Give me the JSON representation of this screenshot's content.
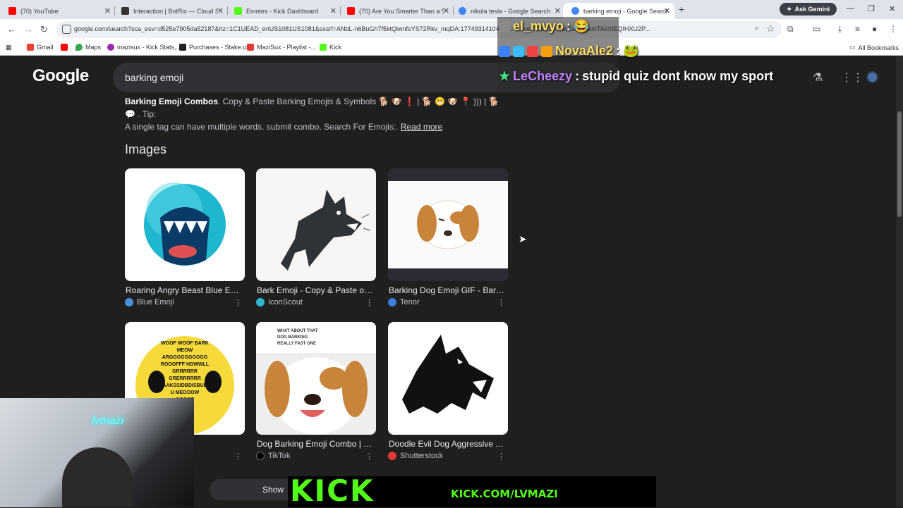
{
  "tabs": [
    {
      "title": "(70) YouTube",
      "icon": "youtube-icon",
      "color": "#ff0000"
    },
    {
      "title": "Interaction | BotRix — Cloud St...",
      "icon": "botrix-icon",
      "color": "#333333"
    },
    {
      "title": "Emotes - Kick Dashboard",
      "icon": "kick-icon",
      "color": "#53fc18"
    },
    {
      "title": "(70) Are You Smarter Than a 5th...",
      "icon": "youtube-icon",
      "color": "#ff0000"
    },
    {
      "title": "nikola tesla - Google Search",
      "icon": "google-icon",
      "color": "#4285f4"
    },
    {
      "title": "barking emoji - Google Search",
      "icon": "google-icon",
      "color": "#4285f4"
    }
  ],
  "ask_gemini": "Ask Gemini",
  "address_bar": {
    "url": "google.com/search?sca_esv=d525e7905da52187&rlz=1C1UEAD_enUS1081US1081&sxsrf=ANbL-n6BuGh7f5ktQiwnfsYS72Rkv_mqDA:1774931410483...=X&ved=2ahUKEwjXieHhpsmTAxXIEQIHXU2P..."
  },
  "bookmarks": [
    {
      "label": "Gmail",
      "color": "#ea4335"
    },
    {
      "label": "",
      "color": "#ff0000"
    },
    {
      "label": "Maps",
      "color": "#34a853"
    },
    {
      "label": "mazisux - Kick Stats,...",
      "color": "#9c27b0"
    },
    {
      "label": "Purchases - Stake.us",
      "color": "#222222"
    },
    {
      "label": "MaziSux - Playlist -...",
      "color": "#e53935"
    },
    {
      "label": "Kick",
      "color": "#53fc18"
    }
  ],
  "all_bookmarks": "All Bookmarks",
  "google": {
    "logo": "Google",
    "query": "barking emoji",
    "snippet_bold": "Barking Emoji Combos",
    "snippet_line1": ". Copy & Paste Barking Emojis & Symbols 🐕 🐶 ❗ | 🐕 😬 🐶 📍 ))) | 🐕 💬 . Tip:",
    "snippet_line2": "A single tag can have multiple words. submit combo. Search For Emojis:.",
    "read_more": "Read more",
    "images_heading": "Images",
    "images": [
      {
        "caption": "Roaring Angry Beast Blue Emoji",
        "source": "Blue Emoji",
        "source_color": "#4a90d9"
      },
      {
        "caption": "Bark Emoji - Copy & Paste or ...",
        "source": "IconScout",
        "source_color": "#2fb5d2"
      },
      {
        "caption": "Barking Dog Emoji GIF - Barki...",
        "source": "Tenor",
        "source_color": "#3b7ddd"
      },
      {
        "caption": "ark Sticker",
        "source": "",
        "source_color": "#888888"
      },
      {
        "caption": "Dog Barking Emoji Combo | Ti...",
        "source": "TikTok",
        "source_color": "#000000"
      },
      {
        "caption": "Doodle Evil Dog Aggressive A...",
        "source": "Shutterstock",
        "source_color": "#e53935"
      }
    ],
    "sticker_text": "WOOF WOOF BARK MEOW ARGGGGGGGGGG ROOOFFF HOWWLL GRRRRRR GRERRRRRR AAKSSIDBDISBUD U MEOOOW OOOOF",
    "tiktok_text": "WHAT ABOUT THAT DOG BARKING REALLY FAST ONE",
    "show_more": "Show"
  },
  "chat": [
    {
      "user": "el_mvyo",
      "message": "😂",
      "color": "#ffe066"
    },
    {
      "user": "NovaAle2",
      "message": "🐸",
      "color": "#ffe066"
    },
    {
      "user": "LeCheezy",
      "message": "stupid quiz dont know my sport",
      "color": "#c084fc"
    }
  ],
  "webcam_label": "lvmazi",
  "kick": {
    "logo": "KICK",
    "url": "KICK.COM/LVMAZI"
  }
}
